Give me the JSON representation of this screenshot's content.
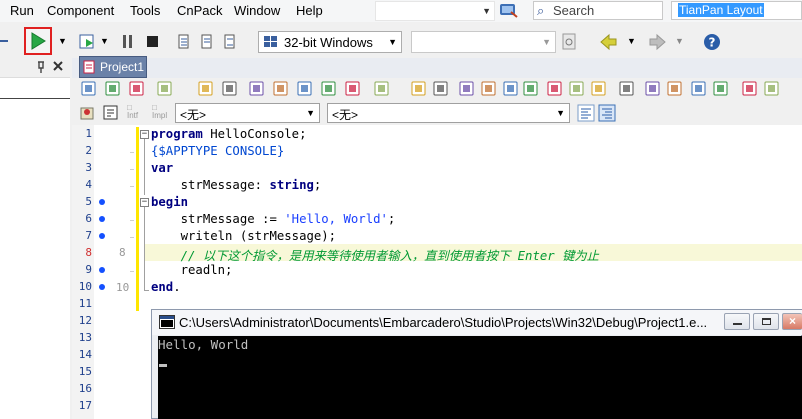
{
  "menu": {
    "items": [
      "Run",
      "Component",
      "Tools",
      "CnPack",
      "Window",
      "Help"
    ],
    "search_placeholder": "Search",
    "layout_name": "TianPan Layout"
  },
  "toolbar": {
    "platform": "32-bit Windows"
  },
  "editor": {
    "tab_label": "Project1",
    "combo_left": "<无>",
    "combo_right": "<无>",
    "line_numbers": [
      "1",
      "2",
      "3",
      "4",
      "5",
      "6",
      "7",
      "8",
      "9",
      "10",
      "11",
      "12",
      "13",
      "14",
      "15",
      "16",
      "17"
    ],
    "guide_numbers": [
      "8",
      "10"
    ],
    "code": {
      "line1_kw": "program",
      "line1_rest": " HelloConsole;",
      "line2": "{$APPTYPE CONSOLE}",
      "line3": "var",
      "line4_a": "    strMessage: ",
      "line4_kw": "string",
      "line4_b": ";",
      "line5": "begin",
      "line6_a": "    strMessage := ",
      "line6_str": "'Hello, World'",
      "line6_b": ";",
      "line7": "    writeln (strMessage);",
      "line8": "    // 以下这个指令，是用来等待使用者输入，直到使用者按下 Enter 键为止",
      "line9": "    readln;",
      "line10_kw": "end",
      "line10_b": "."
    }
  },
  "console": {
    "title": "C:\\Users\\Administrator\\Documents\\Embarcadero\\Studio\\Projects\\Win32\\Debug\\Project1.e...",
    "output": "Hello, World"
  },
  "colors": {
    "run_highlight": "#e02020",
    "tab_active": "#6b82a8",
    "keyword": "#000080",
    "comment": "#009933",
    "string": "#1a3fff"
  }
}
